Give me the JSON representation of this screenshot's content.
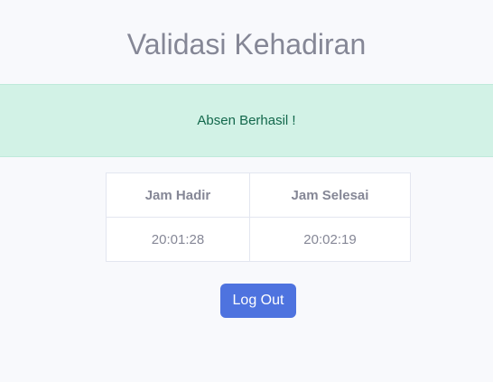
{
  "page": {
    "title": "Validasi Kehadiran"
  },
  "alert": {
    "message": "Absen Berhasil !",
    "color": "#d2f2e6"
  },
  "table": {
    "headers": [
      "Jam Hadir",
      "Jam Selesai"
    ],
    "rows": [
      [
        "20:01:28",
        "20:02:19"
      ]
    ]
  },
  "actions": {
    "logout_label": "Log Out",
    "accent": "#4e73df"
  }
}
